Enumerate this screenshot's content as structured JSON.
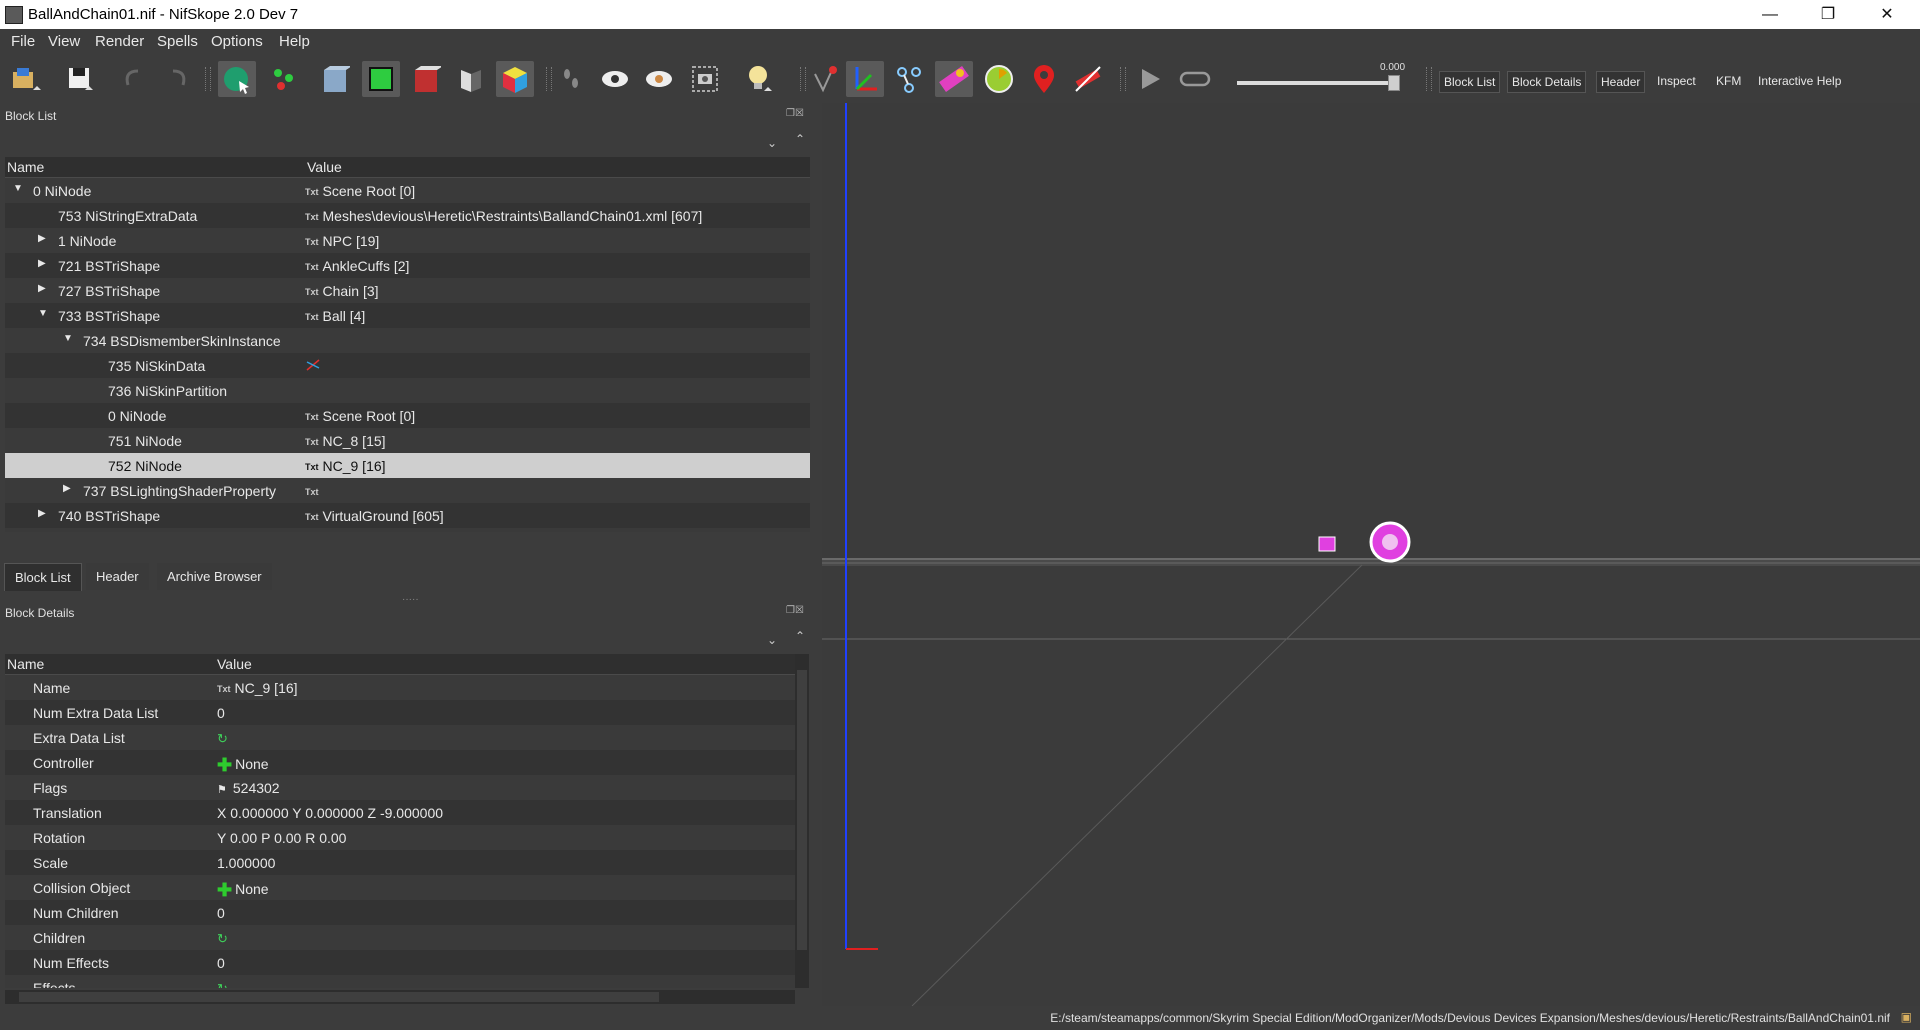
{
  "window": {
    "title": "BallAndChain01.nif - NifSkope 2.0 Dev 7",
    "minimize": "—",
    "maximize": "❐",
    "close": "✕"
  },
  "menu": [
    "File",
    "View",
    "Render",
    "Spells",
    "Options",
    "Help"
  ],
  "toolbar": {
    "slider_value": "0.000",
    "buttons": [
      "Block List",
      "Block Details",
      "Header",
      "Inspect",
      "KFM",
      "Interactive Help"
    ]
  },
  "block_list": {
    "title": "Block List",
    "col_name": "Name",
    "col_value": "Value",
    "rows": [
      {
        "name": "0 NiNode",
        "value": "Scene Root [0]",
        "icon": "Txt"
      },
      {
        "name": "753 NiStringExtraData",
        "value": "Meshes\\devious\\Heretic\\Restraints\\BallandChain01.xml [607]",
        "icon": "Txt"
      },
      {
        "name": "1 NiNode",
        "value": "NPC [19]",
        "icon": "Txt"
      },
      {
        "name": "721 BSTriShape",
        "value": "AnkleCuffs [2]",
        "icon": "Txt"
      },
      {
        "name": "727 BSTriShape",
        "value": "Chain [3]",
        "icon": "Txt"
      },
      {
        "name": "733 BSTriShape",
        "value": "Ball [4]",
        "icon": "Txt"
      },
      {
        "name": "734 BSDismemberSkinInstance",
        "value": "",
        "icon": ""
      },
      {
        "name": "735 NiSkinData",
        "value": "",
        "icon": ""
      },
      {
        "name": "736 NiSkinPartition",
        "value": "",
        "icon": ""
      },
      {
        "name": "0 NiNode",
        "value": "Scene Root [0]",
        "icon": "Txt"
      },
      {
        "name": "751 NiNode",
        "value": "NC_8 [15]",
        "icon": "Txt"
      },
      {
        "name": "752 NiNode",
        "value": "NC_9 [16]",
        "icon": "Txt"
      },
      {
        "name": "737 BSLightingShaderProperty",
        "value": "",
        "icon": "Txt"
      },
      {
        "name": "740 BSTriShape",
        "value": "VirtualGround [605]",
        "icon": "Txt"
      }
    ]
  },
  "tabs": [
    "Block List",
    "Header",
    "Archive Browser"
  ],
  "block_details": {
    "title": "Block Details",
    "col_name": "Name",
    "col_value": "Value",
    "rows": [
      {
        "name": "Name",
        "value": "NC_9 [16]",
        "icon": "Txt"
      },
      {
        "name": "Num Extra Data List",
        "value": "0",
        "icon": ""
      },
      {
        "name": "Extra Data List",
        "value": "",
        "icon": "refresh"
      },
      {
        "name": "Controller",
        "value": "None",
        "icon": "plus"
      },
      {
        "name": "Flags",
        "value": "524302",
        "icon": "flag"
      },
      {
        "name": "Translation",
        "value": "X 0.000000 Y 0.000000 Z -9.000000",
        "icon": ""
      },
      {
        "name": "Rotation",
        "value": "Y 0.00 P 0.00 R 0.00",
        "icon": ""
      },
      {
        "name": "Scale",
        "value": "1.000000",
        "icon": ""
      },
      {
        "name": "Collision Object",
        "value": "None",
        "icon": "plus"
      },
      {
        "name": "Num Children",
        "value": "0",
        "icon": ""
      },
      {
        "name": "Children",
        "value": "",
        "icon": "refresh"
      },
      {
        "name": "Num Effects",
        "value": "0",
        "icon": ""
      },
      {
        "name": "Effects",
        "value": "",
        "icon": "refresh"
      }
    ]
  },
  "status": {
    "path": "E:/steam/steamapps/common/Skyrim Special Edition/ModOrganizer/Mods/Devious Devices Expansion/Meshes/devious/Heretic/Restraints/BallAndChain01.nif"
  }
}
